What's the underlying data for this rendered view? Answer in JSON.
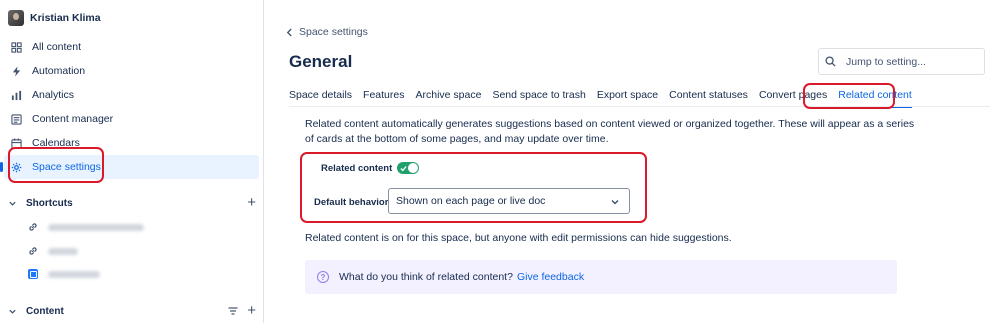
{
  "user": {
    "name": "Kristian Klima"
  },
  "sidebar": {
    "items": [
      {
        "label": "All content",
        "icon": "grid-icon"
      },
      {
        "label": "Automation",
        "icon": "lightning-icon"
      },
      {
        "label": "Analytics",
        "icon": "bar-chart-icon"
      },
      {
        "label": "Content manager",
        "icon": "content-manager-icon"
      },
      {
        "label": "Calendars",
        "icon": "calendar-icon"
      },
      {
        "label": "Space settings",
        "icon": "gear-icon",
        "active": true
      }
    ],
    "shortcuts_label": "Shortcuts",
    "content_label": "Content"
  },
  "main": {
    "back_label": "Space settings",
    "title": "General",
    "search_placeholder": "Jump to setting...",
    "tabs": [
      "Space details",
      "Features",
      "Archive space",
      "Send space to trash",
      "Export space",
      "Content statuses",
      "Convert pages",
      "Related content"
    ],
    "active_tab": "Related content",
    "description": "Related content automatically generates suggestions based on content viewed or organized together. These will appear as a series of cards at the bottom of some pages, and may update over time.",
    "related_label": "Related content",
    "related_enabled": true,
    "default_behavior_label": "Default behavior",
    "default_behavior_value": "Shown on each page or live doc",
    "note": "Related content is on for this space, but anyone with edit permissions can hide suggestions.",
    "feedback_text": "What do you think of related content?",
    "feedback_link": "Give feedback"
  },
  "colors": {
    "accent": "#0c66e4",
    "toggle_on": "#22a06b",
    "highlight": "#d91a2a",
    "feedback_bg": "#f3f0ff"
  }
}
